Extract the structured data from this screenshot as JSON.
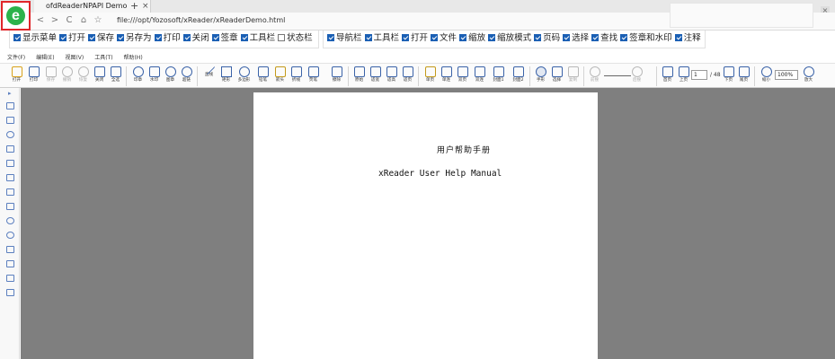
{
  "browser": {
    "tab_title": "ofdReaderNPAPI Demo",
    "tab_close": "×",
    "new_tab": "+",
    "url": "file:///opt/Yozosoft/xReader/xReaderDemo.html",
    "logo_letter": "e",
    "nav": {
      "back": "<",
      "forward": ">",
      "reload": "C",
      "home": "⌂",
      "bookmark": "☆"
    },
    "window_close": "×",
    "window_min": "–"
  },
  "options_left": [
    {
      "label": "显示菜单",
      "checked": true
    },
    {
      "label": "打开",
      "checked": true
    },
    {
      "label": "保存",
      "checked": true
    },
    {
      "label": "另存为",
      "checked": true
    },
    {
      "label": "打印",
      "checked": true
    },
    {
      "label": "关闭",
      "checked": true
    },
    {
      "label": "签章",
      "checked": true
    },
    {
      "label": "工具栏",
      "checked": true
    },
    {
      "label": "状态栏",
      "checked": false
    }
  ],
  "options_right": [
    {
      "label": "导航栏",
      "checked": true
    },
    {
      "label": "工具栏",
      "checked": true
    },
    {
      "label": "打开",
      "checked": true
    },
    {
      "label": "文件",
      "checked": true
    },
    {
      "label": "缩放",
      "checked": true
    },
    {
      "label": "缩放模式",
      "checked": true
    },
    {
      "label": "页码",
      "checked": true
    },
    {
      "label": "选择",
      "checked": true
    },
    {
      "label": "查找",
      "checked": true
    },
    {
      "label": "签章和水印",
      "checked": true
    },
    {
      "label": "注释",
      "checked": true
    }
  ],
  "menu": [
    "文件(F)",
    "编辑(E)",
    "视图(V)",
    "工具(T)",
    "帮助(H)"
  ],
  "toolbar": {
    "open": "打开",
    "print": "打印",
    "save": "保存",
    "undo": "撤销",
    "redo": "恢复",
    "close": "关闭",
    "fullscreen": "全选",
    "seal": "印章",
    "watermark": "水印",
    "image": "图章",
    "hyperlink": "超链",
    "line": "直线",
    "rect": "矩形",
    "polygon": "多边形",
    "pencil": "铅笔",
    "arrow": "箭头",
    "polyline": "折线",
    "highlighter": "荧笔",
    "eraser": "擦除",
    "original": "原始",
    "fit_width": "适宽",
    "fit_height": "适高",
    "fit_page": "适页",
    "single": "单页",
    "single_continuous": "单连",
    "double": "双页",
    "double_continuous": "双连",
    "cover1": "封面1",
    "cover2": "封面2",
    "hand": "手形",
    "select": "选择",
    "copy": "复制",
    "prev_find": "前搜",
    "next_find": "后搜",
    "first": "首页",
    "prev": "上页",
    "next": "下页",
    "last": "尾页",
    "zoom_out": "缩小",
    "zoom_in": "放大",
    "current_page": "1",
    "total_pages": "/ 48",
    "zoom_value": "100%"
  },
  "document": {
    "title": "用户帮助手册",
    "subtitle": "xReader User Help Manual"
  }
}
